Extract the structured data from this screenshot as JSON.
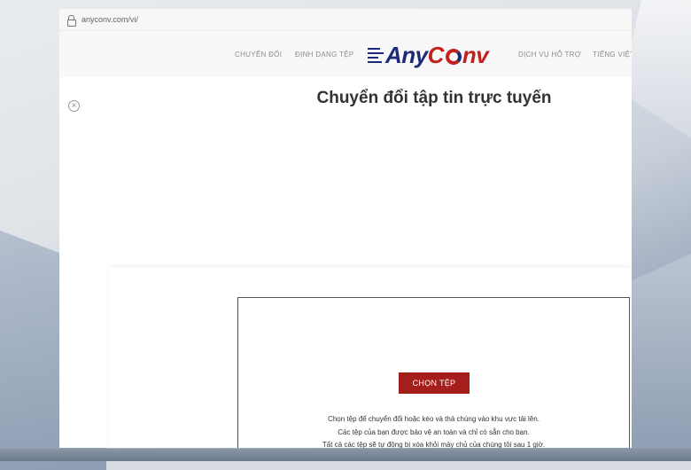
{
  "browser": {
    "url": "anyconv.com/vi/"
  },
  "nav": {
    "items": [
      "CHUYỂN ĐỔI",
      "ĐỊNH DẠNG TỆP",
      "DỊCH VỤ HỖ TRỢ",
      "TIẾNG VIỆT"
    ],
    "logo_any": "Any",
    "logo_c": "C",
    "logo_nv": "nv"
  },
  "main": {
    "title": "Chuyển đổi tập tin trực tuyến",
    "choose_button": "CHỌN TỆP",
    "notes": [
      "Chọn tệp để chuyển đổi hoặc kéo và thả chúng vào khu vực tải lên.",
      "Các tệp của bạn được bảo vệ an toàn và chỉ có sẵn cho bạn.",
      "Tất cả các tệp sẽ tự động bị xóa khỏi máy chủ của chúng tôi sau 1 giờ."
    ]
  },
  "icons": {
    "lock": "lock-icon",
    "close": "close-icon"
  },
  "colors": {
    "brand_blue": "#1d2a7a",
    "brand_red": "#c0231e",
    "button_red": "#a51e1b"
  }
}
